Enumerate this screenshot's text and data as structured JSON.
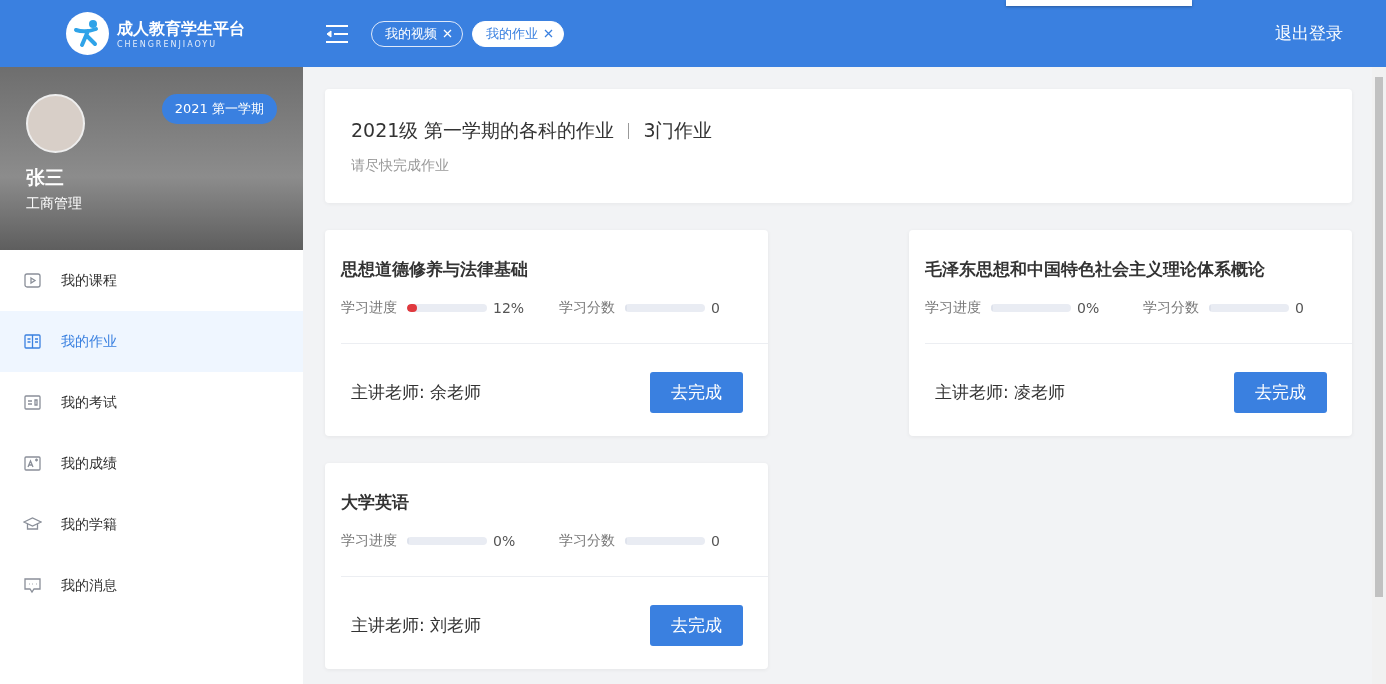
{
  "header": {
    "logo_title": "成人教育学生平台",
    "logo_subtitle": "CHENGRENJIAOYU",
    "tabs": [
      {
        "label": "我的视频",
        "selected": false
      },
      {
        "label": "我的作业",
        "selected": true
      }
    ],
    "logout": "退出登录"
  },
  "profile": {
    "term": "2021 第一学期",
    "name": "张三",
    "major": "工商管理"
  },
  "sidebar": {
    "items": [
      {
        "label": "我的课程",
        "kind": "play",
        "selected": false
      },
      {
        "label": "我的作业",
        "kind": "book",
        "selected": true
      },
      {
        "label": "我的考试",
        "kind": "exam",
        "selected": false
      },
      {
        "label": "我的成绩",
        "kind": "grade",
        "selected": false
      },
      {
        "label": "我的学籍",
        "kind": "cap",
        "selected": false
      },
      {
        "label": "我的消息",
        "kind": "message",
        "selected": false
      }
    ]
  },
  "summary": {
    "title": "2021级 第一学期的各科的作业",
    "count": "3门作业",
    "subtitle": "请尽快完成作业"
  },
  "courses": [
    {
      "title": "思想道德修养与法律基础",
      "progress_label": "学习进度",
      "progress": {
        "level": 0.12
      },
      "progress_text": "12%",
      "score_label": "学习分数",
      "score": {
        "level": 0
      },
      "score_text": "0",
      "teacher": "主讲老师: 余老师",
      "action": "去完成"
    },
    {
      "title": "毛泽东思想和中国特色社会主义理论体系概论",
      "progress_label": "学习进度",
      "progress": {
        "level": 0
      },
      "progress_text": "0%",
      "score_label": "学习分数",
      "score": {
        "level": 0
      },
      "score_text": "0",
      "teacher": "主讲老师: 凌老师",
      "action": "去完成"
    },
    {
      "title": "大学英语",
      "progress_label": "学习进度",
      "progress": {
        "level": 0
      },
      "progress_text": "0%",
      "score_label": "学习分数",
      "score": {
        "level": 0
      },
      "score_text": "0",
      "teacher": "主讲老师: 刘老师",
      "action": "去完成"
    }
  ]
}
